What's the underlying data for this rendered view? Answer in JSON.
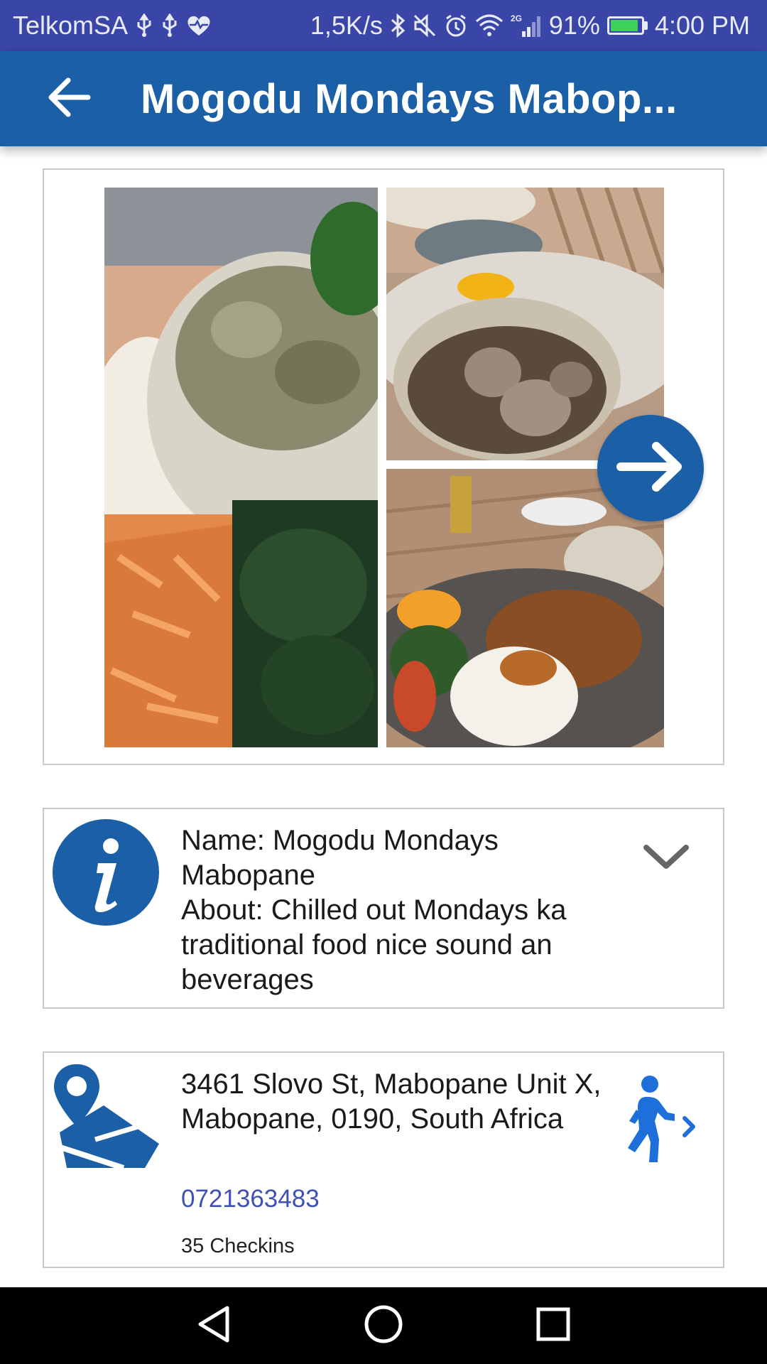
{
  "status_bar": {
    "carrier": "TelkomSA",
    "speed": "1,5K/s",
    "network": "2G",
    "battery": "91%",
    "battery_level": 0.91,
    "time": "4:00 PM",
    "icons": [
      "usb-icon",
      "usb-icon",
      "heart-pulse-icon",
      "bluetooth-icon",
      "mute-icon",
      "alarm-icon",
      "wifi-icon",
      "signal-icon",
      "battery-icon"
    ]
  },
  "app_bar": {
    "title": "Mogodu Mondays Mabop...",
    "back_icon": "arrow-left-icon"
  },
  "gallery": {
    "next_icon": "arrow-right-icon"
  },
  "info": {
    "name_line": "Name: Mogodu Mondays Mabopane",
    "about_line": "About: Chilled out Mondays ka traditional food nice sound an beverages",
    "icon": "info-icon",
    "expand_icon": "chevron-down-icon"
  },
  "location": {
    "address": "3461 Slovo St, Mabopane Unit X, Mabopane, 0190, South Africa",
    "phone": "0721363483",
    "checkins": "35 Checkins",
    "icon": "map-pin-icon",
    "directions_icon": "walking-icon"
  },
  "colors": {
    "status_bar": "#3a45a8",
    "app_bar": "#1b5fa6",
    "accent": "#1b5fa6",
    "link": "#3f51b5",
    "walk_icon": "#1e6fd9"
  }
}
